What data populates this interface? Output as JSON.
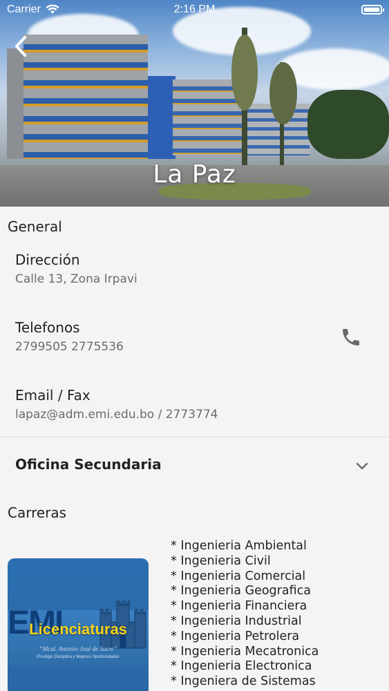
{
  "status_bar": {
    "carrier": "Carrier",
    "time": "2:16 PM"
  },
  "header": {
    "title": "La Paz"
  },
  "general": {
    "section_title": "General",
    "address": {
      "label": "Dirección",
      "value": "Calle 13, Zona Irpavi"
    },
    "phones": {
      "label": "Telefonos",
      "value": "2799505   2775536"
    },
    "email": {
      "label": "Email / Fax",
      "value": "lapaz@adm.emi.edu.bo / 2773774"
    }
  },
  "secondary_office": {
    "label": "Oficina Secundaria"
  },
  "careers": {
    "section_title": "Carreras",
    "card": {
      "logo_text": "EMI",
      "title": "Licenciaturas",
      "subtitle": "“Mcal. Antonio José de Sucre”",
      "tagline": "Prestigio Disciplina y Mejores Oportunidades"
    },
    "items": [
      "Ingenieria Ambiental",
      "Ingenieria Civil",
      "Ingenieria Comercial",
      "Ingenieria Geografica",
      "Ingenieria Financiera",
      "Ingenieria Industrial",
      "Ingenieria Petrolera",
      "Ingenieria Mecatronica",
      "Ingenieria Electronica",
      "Ingeniera de Sistemas"
    ]
  },
  "icons": {
    "back": "chevron-left-icon",
    "phone": "phone-icon",
    "expand": "chevron-down-icon",
    "wifi": "wifi-icon",
    "battery": "battery-icon"
  },
  "colors": {
    "background": "#f4f4f4",
    "icon_gray": "#6b6b6b",
    "card_blue": "#2b6fb0",
    "card_title_yellow": "#f5d21a"
  }
}
